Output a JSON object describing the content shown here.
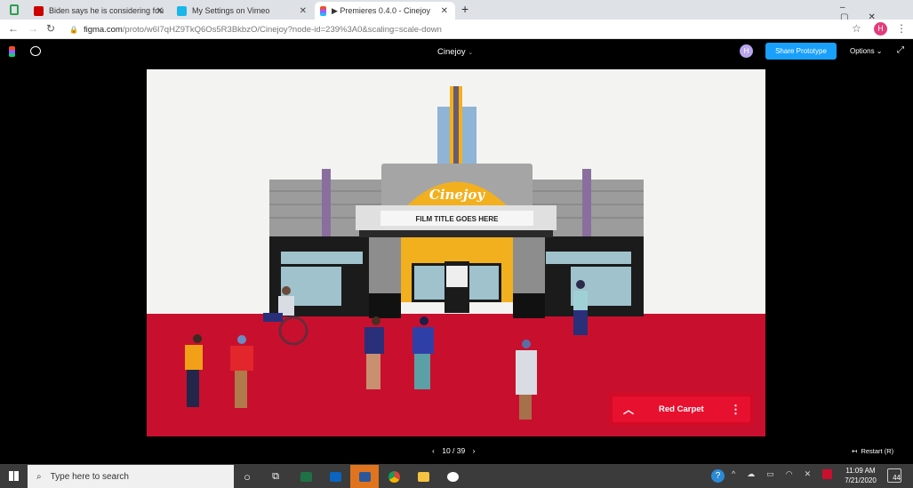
{
  "browser": {
    "tabs": [
      {
        "label": "Biden says he is considering fou",
        "icon": "cnn-icon"
      },
      {
        "label": "My Settings on Vimeo",
        "icon": "vimeo-icon"
      },
      {
        "label": "▶ Premieres 0.4.0 - Cinejoy",
        "icon": "figma-icon",
        "active": true
      }
    ],
    "new_tab": "+",
    "url_host": "figma.com",
    "url_path": "/proto/w6I7qHZ9TkQ6Os5R3BkbzO/Cinejoy?node-id=239%3A0&scaling=scale-down",
    "profile_initial": "H"
  },
  "figma": {
    "title": "Cinejoy",
    "share_label": "Share Prototype",
    "options_label": "Options",
    "page_counter": "10 / 39",
    "restart_label": "Restart (R)",
    "avatar_initial": "H"
  },
  "scene": {
    "logo_text": "Cinejoy",
    "marquee_text": "FILM TITLE GOES HERE",
    "hotspot_label": "Red Carpet",
    "colors": {
      "carpet": "#c8102e",
      "accent": "#f2b01e",
      "button": "#e8102f"
    }
  },
  "taskbar": {
    "search_placeholder": "Type here to search",
    "time": "11:09 AM",
    "date": "7/21/2020",
    "notifications": "44"
  }
}
